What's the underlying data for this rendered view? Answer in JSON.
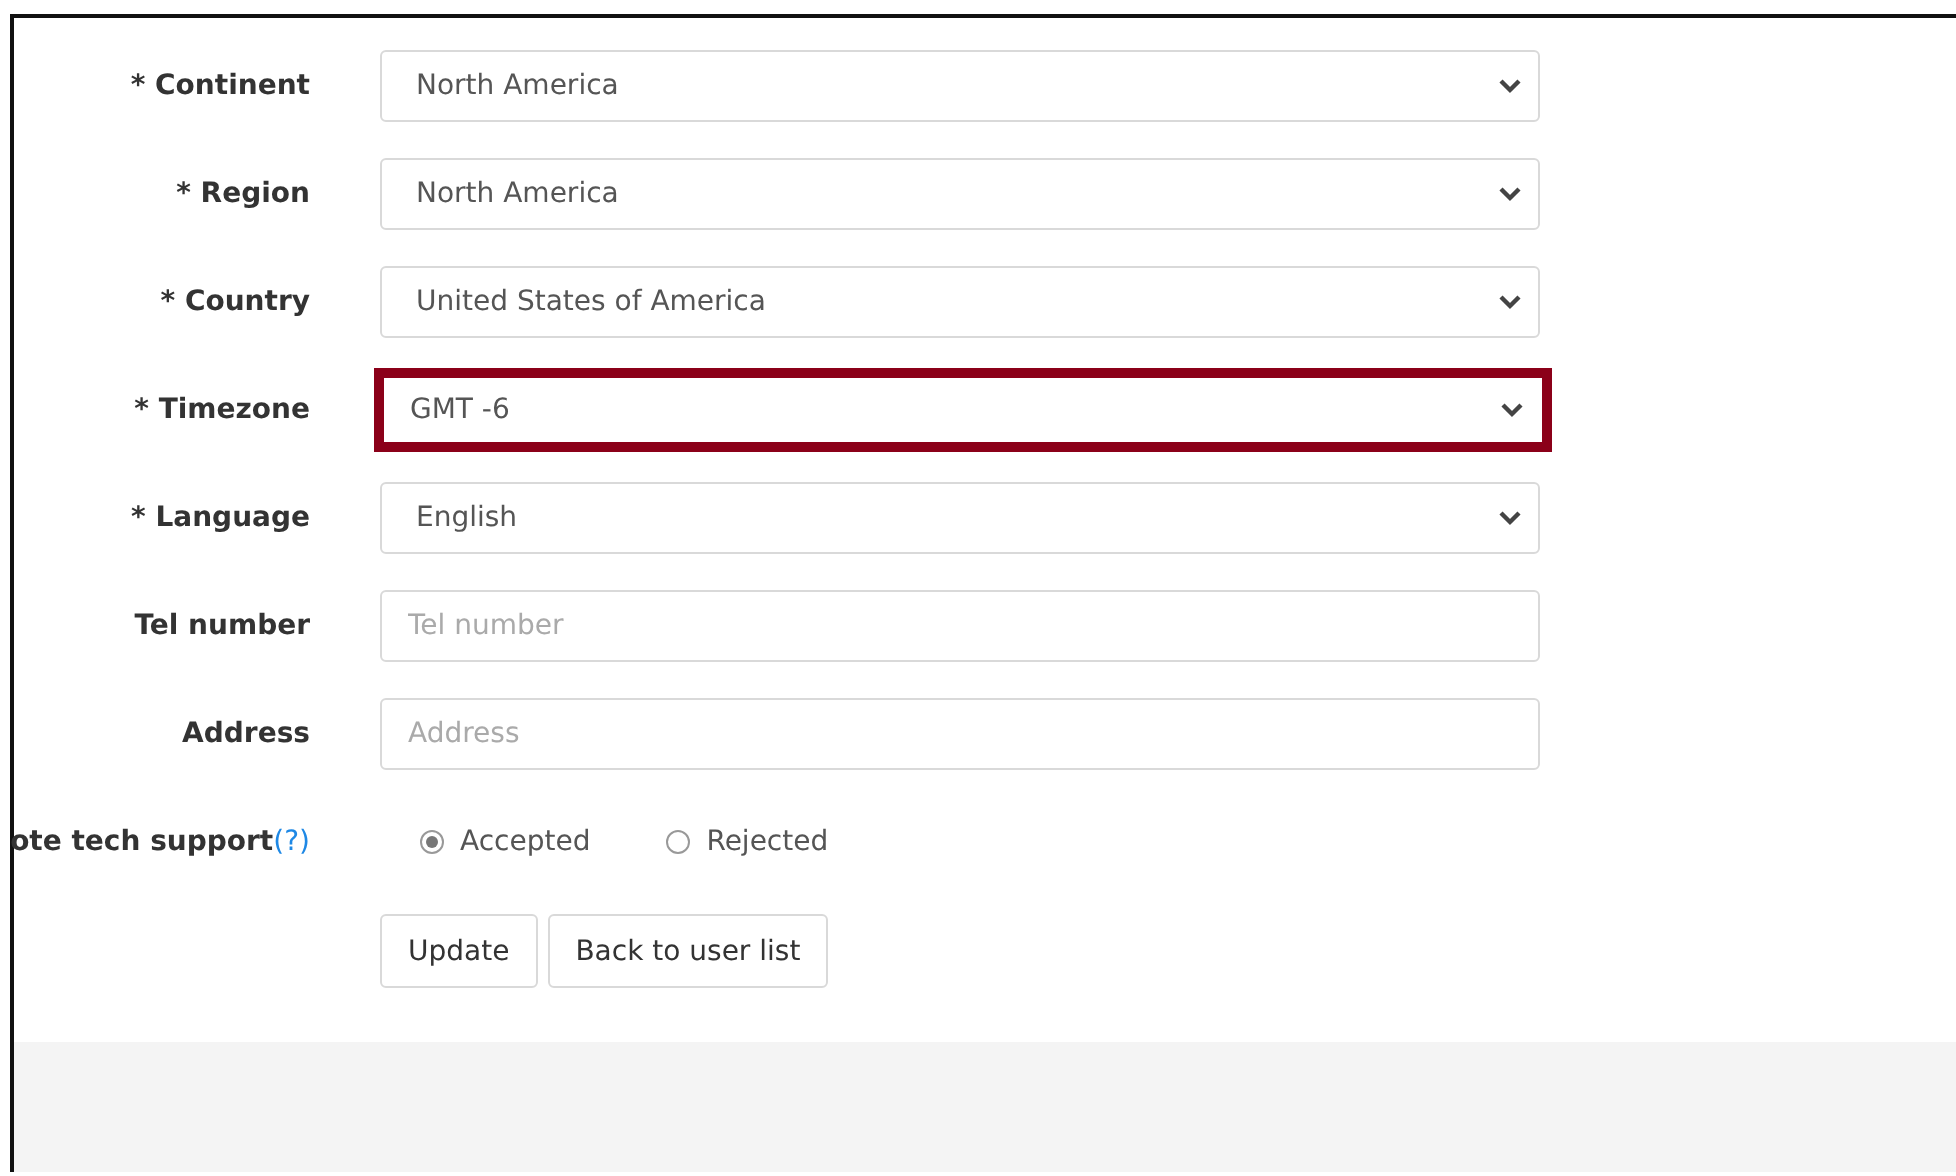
{
  "fields": [
    {
      "kind": "select",
      "label": "* Continent",
      "value": "North America",
      "highlighted": false
    },
    {
      "kind": "select",
      "label": "* Region",
      "value": "North America",
      "highlighted": false
    },
    {
      "kind": "select",
      "label": "* Country",
      "value": "United States of America",
      "highlighted": false
    },
    {
      "kind": "select",
      "label": "* Timezone",
      "value": "GMT -6",
      "highlighted": true
    },
    {
      "kind": "select",
      "label": "* Language",
      "value": "English",
      "highlighted": false
    },
    {
      "kind": "text",
      "label": "Tel number",
      "placeholder": "Tel number"
    },
    {
      "kind": "text",
      "label": "Address",
      "placeholder": "Address"
    },
    {
      "kind": "radio",
      "label": "ote tech support",
      "help": "(?)",
      "options": [
        {
          "label": "Accepted",
          "selected": true
        },
        {
          "label": "Rejected",
          "selected": false
        }
      ]
    }
  ],
  "buttons": [
    "Update",
    "Back to user list"
  ]
}
